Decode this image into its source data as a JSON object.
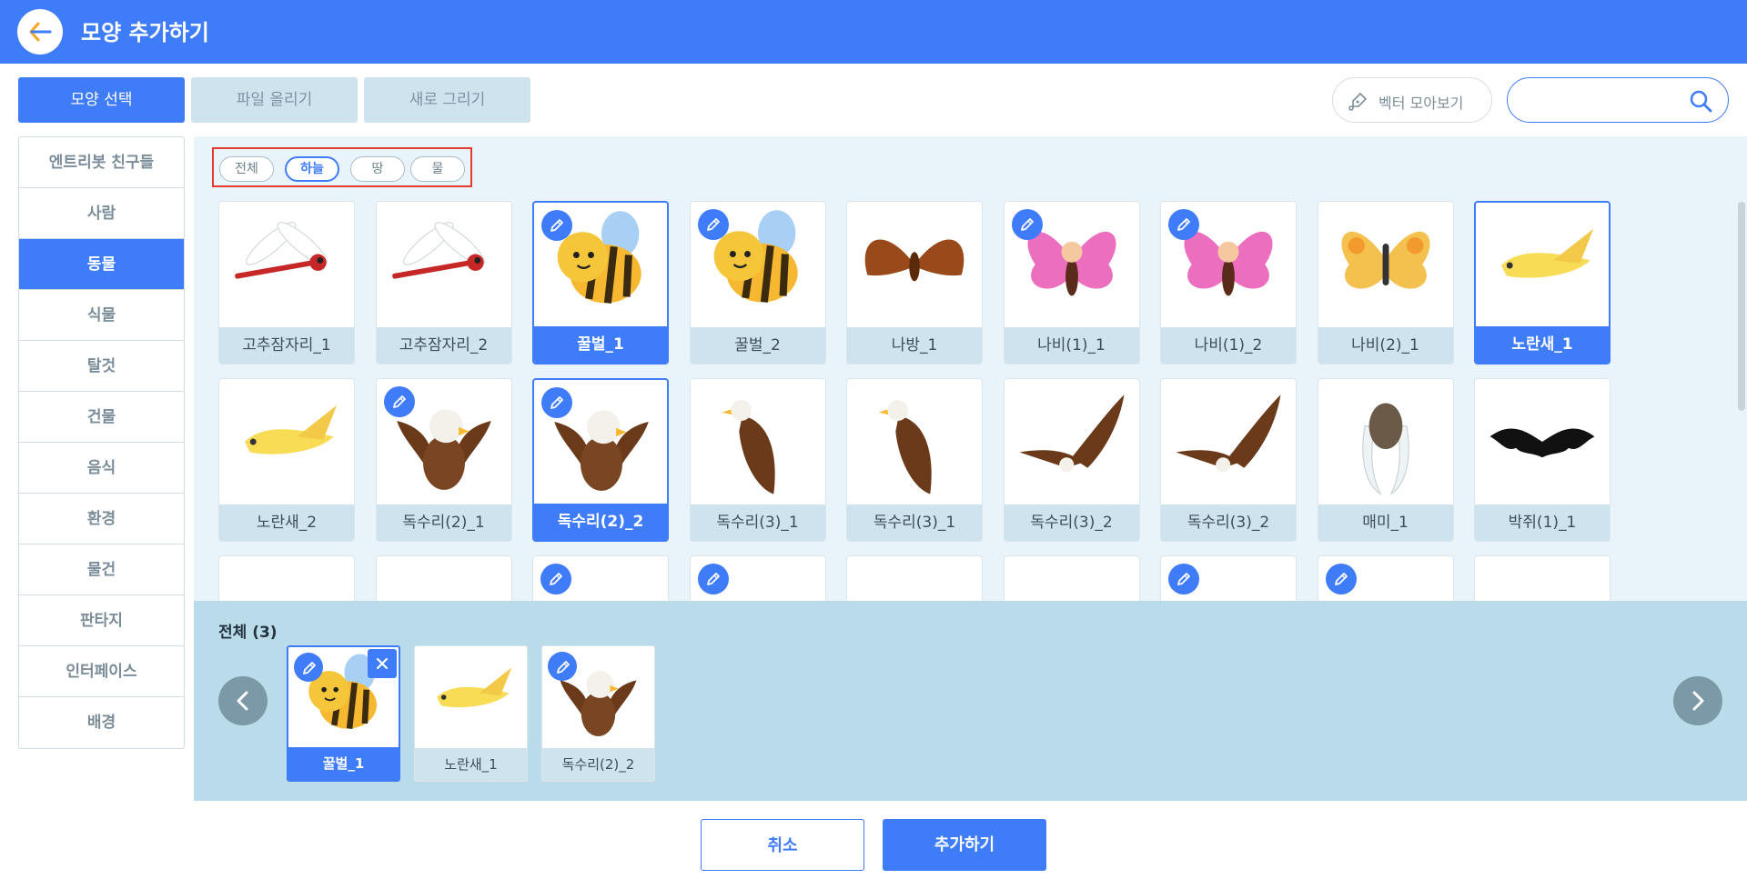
{
  "header": {
    "title": "모양 추가하기",
    "back_icon": "arrow-left-icon",
    "accent": "#3f7cfa"
  },
  "tabs": [
    {
      "label": "모양 선택",
      "active": true
    },
    {
      "label": "파일 올리기",
      "active": false
    },
    {
      "label": "새로 그리기",
      "active": false
    }
  ],
  "toolbar": {
    "vector_label": "벡터 모아보기",
    "search_placeholder": ""
  },
  "sidebar": {
    "items": [
      {
        "label": "엔트리봇 친구들"
      },
      {
        "label": "사람"
      },
      {
        "label": "동물",
        "active": true
      },
      {
        "label": "식물"
      },
      {
        "label": "탈것"
      },
      {
        "label": "건물"
      },
      {
        "label": "음식"
      },
      {
        "label": "환경"
      },
      {
        "label": "물건"
      },
      {
        "label": "판타지"
      },
      {
        "label": "인터페이스"
      },
      {
        "label": "배경"
      }
    ]
  },
  "filters": [
    {
      "label": "전체"
    },
    {
      "label": "하늘",
      "active": true
    },
    {
      "label": "땅"
    },
    {
      "label": "물"
    }
  ],
  "grid": {
    "items": [
      {
        "name": "고추잠자리_1",
        "icon": "dragonfly-icon",
        "vector": false,
        "selected": false
      },
      {
        "name": "고추잠자리_2",
        "icon": "dragonfly-icon",
        "vector": false,
        "selected": false
      },
      {
        "name": "꿀벌_1",
        "icon": "bee-icon",
        "vector": true,
        "selected": true
      },
      {
        "name": "꿀벌_2",
        "icon": "bee-icon",
        "vector": true,
        "selected": false
      },
      {
        "name": "나방_1",
        "icon": "moth-icon",
        "vector": false,
        "selected": false
      },
      {
        "name": "나비(1)_1",
        "icon": "butterfly-pink-icon",
        "vector": true,
        "selected": false
      },
      {
        "name": "나비(1)_2",
        "icon": "butterfly-pink-icon",
        "vector": true,
        "selected": false
      },
      {
        "name": "나비(2)_1",
        "icon": "butterfly-yellow-icon",
        "vector": false,
        "selected": false
      },
      {
        "name": "노란새_1",
        "icon": "yellow-bird-icon",
        "vector": false,
        "selected": true
      },
      {
        "name": "노란새_2",
        "icon": "yellow-bird-icon",
        "vector": false,
        "selected": false
      },
      {
        "name": "독수리(2)_1",
        "icon": "eagle-icon",
        "vector": true,
        "selected": false
      },
      {
        "name": "독수리(2)_2",
        "icon": "eagle-icon",
        "vector": true,
        "selected": true
      },
      {
        "name": "독수리(3)_1",
        "icon": "eagle-perched-icon",
        "vector": false,
        "selected": false
      },
      {
        "name": "독수리(3)_1",
        "icon": "eagle-perched-icon",
        "vector": false,
        "selected": false
      },
      {
        "name": "독수리(3)_2",
        "icon": "eagle-flying-icon",
        "vector": false,
        "selected": false
      },
      {
        "name": "독수리(3)_2",
        "icon": "eagle-flying-icon",
        "vector": false,
        "selected": false
      },
      {
        "name": "매미_1",
        "icon": "cicada-icon",
        "vector": false,
        "selected": false
      },
      {
        "name": "박쥐(1)_1",
        "icon": "bat-icon",
        "vector": false,
        "selected": false
      },
      {
        "name": "",
        "icon": "bat-wing-icon",
        "vector": false,
        "selected": false
      },
      {
        "name": "",
        "icon": "white-bird-icon",
        "vector": false,
        "selected": false
      },
      {
        "name": "",
        "icon": "bat-icon",
        "vector": true,
        "selected": false
      },
      {
        "name": "",
        "icon": "bat-icon",
        "vector": true,
        "selected": false
      },
      {
        "name": "",
        "icon": "bat-head-icon",
        "vector": false,
        "selected": false
      },
      {
        "name": "",
        "icon": "bat-head-icon",
        "vector": false,
        "selected": false
      },
      {
        "name": "",
        "icon": "owl-icon",
        "vector": true,
        "selected": false
      },
      {
        "name": "",
        "icon": "owl-icon",
        "vector": true,
        "selected": false
      },
      {
        "name": "",
        "icon": "red-bird-icon",
        "vector": false,
        "selected": false
      }
    ]
  },
  "tray": {
    "title": "전체 (3)",
    "items": [
      {
        "name": "꿀벌_1",
        "icon": "bee-icon",
        "vector": true,
        "selected": true,
        "removable": true
      },
      {
        "name": "노란새_1",
        "icon": "yellow-bird-icon",
        "vector": false,
        "selected": false
      },
      {
        "name": "독수리(2)_2",
        "icon": "eagle-icon",
        "vector": true,
        "selected": false
      }
    ]
  },
  "actions": {
    "cancel_label": "취소",
    "add_label": "추가하기"
  }
}
